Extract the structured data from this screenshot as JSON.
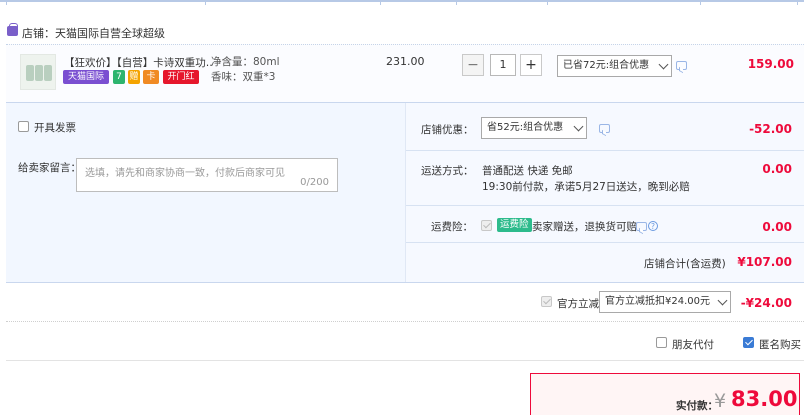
{
  "shop": {
    "label": "店铺：天猫国际自营全球超级",
    "icon": "shop-icon"
  },
  "item": {
    "title": "【狂欢价】【自营】卡诗双重功…",
    "badges": [
      {
        "text": "天猫国际",
        "color": "#7a4fd1"
      },
      {
        "text": "7",
        "color": "#2db46e"
      },
      {
        "text": "赠",
        "color": "#f4a300"
      },
      {
        "text": "卡",
        "color": "#f08a24"
      },
      {
        "text": "开门红",
        "color": "#e6172c"
      }
    ],
    "props": [
      "净含量：80ml",
      "香味：双重*3"
    ],
    "unit_price": "231.00",
    "qty": "1",
    "qty_minus": "−",
    "qty_plus": "+",
    "promo_select": "已省72元:组合优惠",
    "subtotal": "159.00"
  },
  "invoice": {
    "label": "开具发票"
  },
  "message": {
    "label": "给卖家留言：",
    "placeholder": "选填，请先和商家协商一致，付款后商家可见",
    "count": "0/200"
  },
  "shop_discount": {
    "label": "店铺优惠：",
    "select": "省52元:组合优惠",
    "value": "-52.00"
  },
  "shipping": {
    "label": "运送方式：",
    "line1": "普通配送 快递 免邮",
    "line2": "19:30前付款，承诺5月27日送达，晚到必赔",
    "value": "0.00"
  },
  "freight_ins": {
    "label": "运费险：",
    "tag": "运费险",
    "desc": "卖家赠送，退换货可赔",
    "help": "?",
    "value": "0.00"
  },
  "shop_total": {
    "label": "店铺合计(含运费)",
    "value": "¥107.00"
  },
  "official": {
    "label": "官方立减",
    "select": "官方立减抵扣¥24.00元",
    "value": "-¥24.00"
  },
  "options": {
    "friend_pay": "朋友代付",
    "anonymous": "匿名购买"
  },
  "payment": {
    "label": "实付款：",
    "currency": "¥",
    "amount": "83.00"
  },
  "colors": {
    "accent": "#ee0a3b",
    "link": "#3a7bd5"
  }
}
